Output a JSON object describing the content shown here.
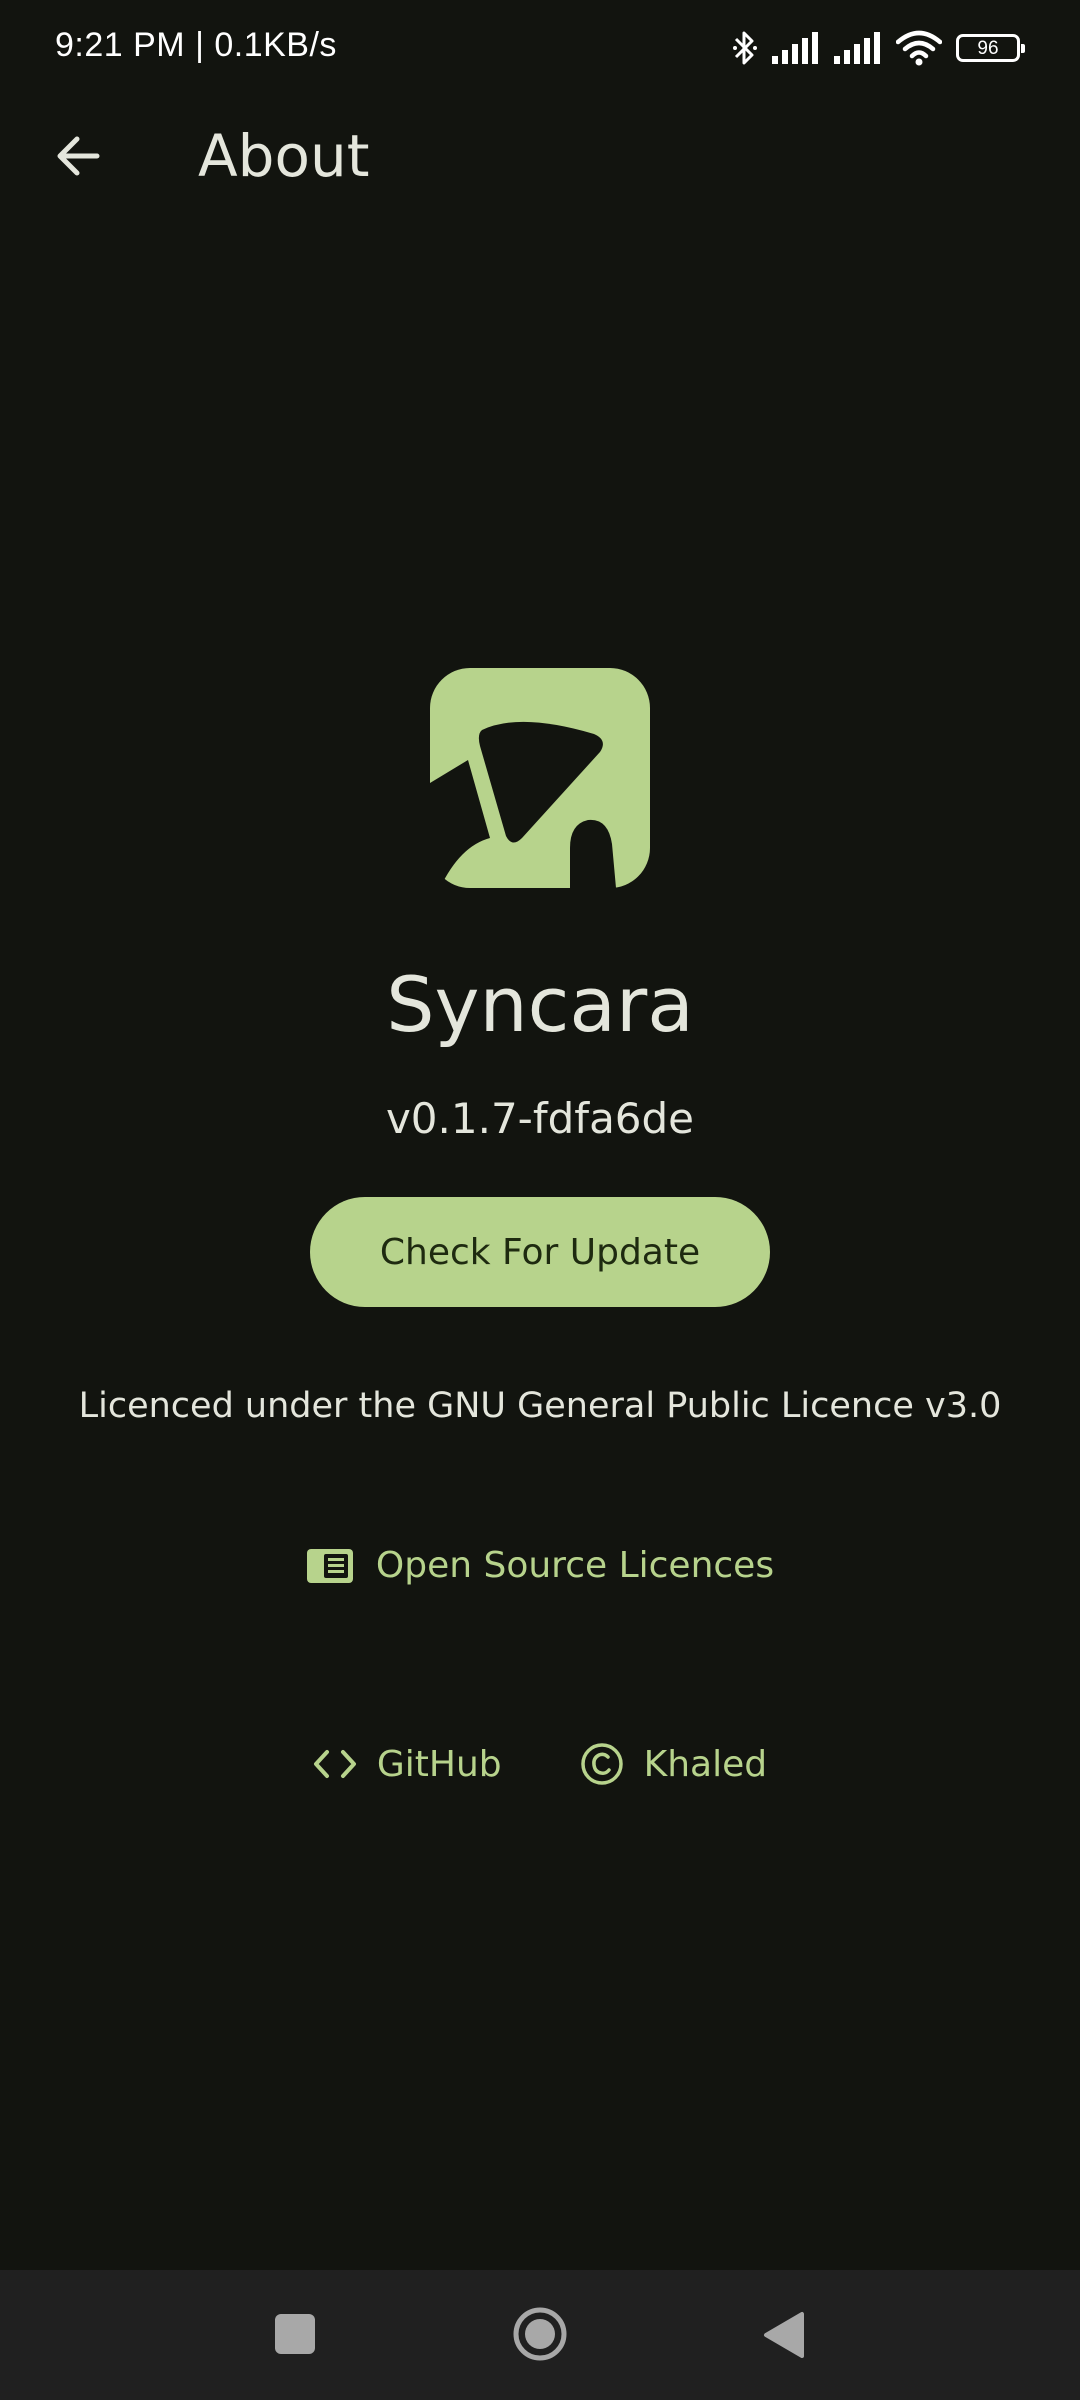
{
  "status_bar": {
    "time": "9:21 PM | 0.1KB/s",
    "battery": "96",
    "icons": [
      "bluetooth-icon",
      "signal-icon",
      "signal-icon",
      "wifi-icon",
      "battery-icon"
    ]
  },
  "app_bar": {
    "title": "About",
    "back_icon": "arrow-back-icon"
  },
  "app": {
    "name": "Syncara",
    "version": "v0.1.7-fdfa6de",
    "logo_icon": "syncara-logo"
  },
  "actions": {
    "check_update_label": "Check For Update"
  },
  "licence": {
    "text": "Licenced under the GNU General Public Licence v3.0"
  },
  "links": {
    "open_source_label": "Open Source Licences",
    "open_source_icon": "licence-book-icon",
    "github_label": "GitHub",
    "github_icon": "code-icon",
    "author_label": "Khaled",
    "author_icon": "copyright-icon"
  },
  "nav_bar": {
    "buttons": [
      "recents-icon",
      "home-icon",
      "back-triangle-icon"
    ]
  },
  "colors": {
    "background": "#12140f",
    "accent": "#b7d38c",
    "text": "#e4e6dc",
    "nav_background": "#202020"
  }
}
